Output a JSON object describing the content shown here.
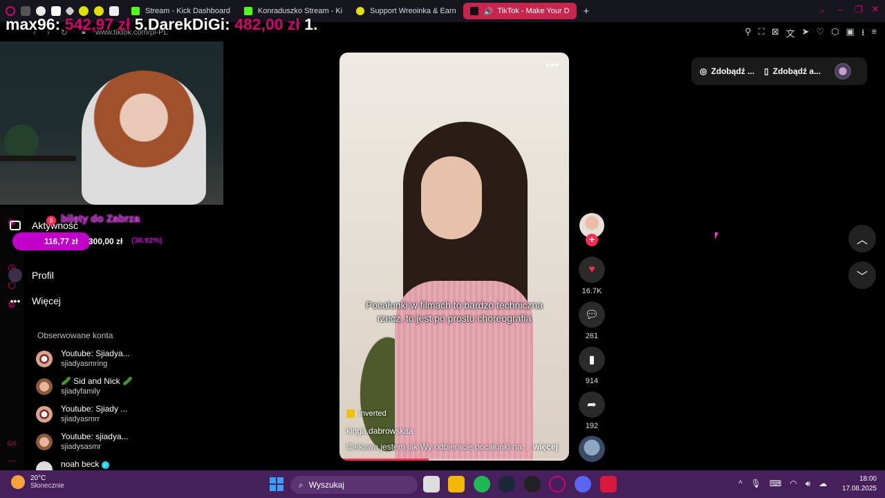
{
  "browser": {
    "tabs": [
      {
        "label": "Stream - Kick Dashboard",
        "color": "#53fc18"
      },
      {
        "label": "Konraduszko Stream - Ki",
        "color": "#53fc18"
      },
      {
        "label": "Support Wreoinka & Earn",
        "color": "#e0e000"
      },
      {
        "label": "TikTok - Make Your D",
        "color": "#ffffff"
      }
    ],
    "new_tab": "+",
    "url": "www.tiktok.com/pl-PL"
  },
  "stream_overlay": {
    "ticker_user1": "max96",
    "ticker_sep1": ":",
    "ticker_amt1": "542,97 zł",
    "ticker_rank": "5.",
    "ticker_user2": "DarekDiGi",
    "ticker_sep2": ":",
    "ticker_amt2": "482,00 zł",
    "ticker_rank2": "1.",
    "goal_title": "bilety do Zabrza",
    "goal_current": "116,77 zł",
    "goal_target": "300,00 zł",
    "goal_percent": "(38.92%)",
    "goal_fraction": 0.3892
  },
  "sidebar": {
    "items": [
      {
        "label": "Aktywność",
        "badge": "9"
      },
      {
        "label": "Profil"
      },
      {
        "label": "Więcej"
      }
    ],
    "following_title": "Obserwowane konta",
    "accounts": [
      {
        "name": "Youtube: Sjiadya...",
        "handle": "sjiadyasmring"
      },
      {
        "name": "🥒 Sid and Nick 🥒",
        "handle": "sjiadyfamily"
      },
      {
        "name": "Youtube: Sjiady ...",
        "handle": "sjiadyasmrr"
      },
      {
        "name": "Youtube: sjiadya...",
        "handle": "sjiadysasmr"
      },
      {
        "name": "noah beck",
        "handle": ""
      }
    ]
  },
  "video": {
    "caption": "Pocałunki w filmach to bardzo techniczna rzecz, to jest po prostu choreografia",
    "effect": "Inverted",
    "author": "kinga.dabrowskaa",
    "description": "Ciekawa jestem jak Wy odbieracie pocałunki na...",
    "more": "więcej",
    "menu": "•••",
    "progress": 0.39
  },
  "actions": {
    "likes": "16.7K",
    "comments": "261",
    "saves": "914",
    "shares": "192"
  },
  "top_right": {
    "pill1": "Zdobądź ...",
    "pill2": "Zdobądź a..."
  },
  "taskbar": {
    "temp": "20°C",
    "weather": "Słonecznie",
    "search": "Wyszukaj",
    "time": "18:00",
    "date": "17.08.2025"
  }
}
